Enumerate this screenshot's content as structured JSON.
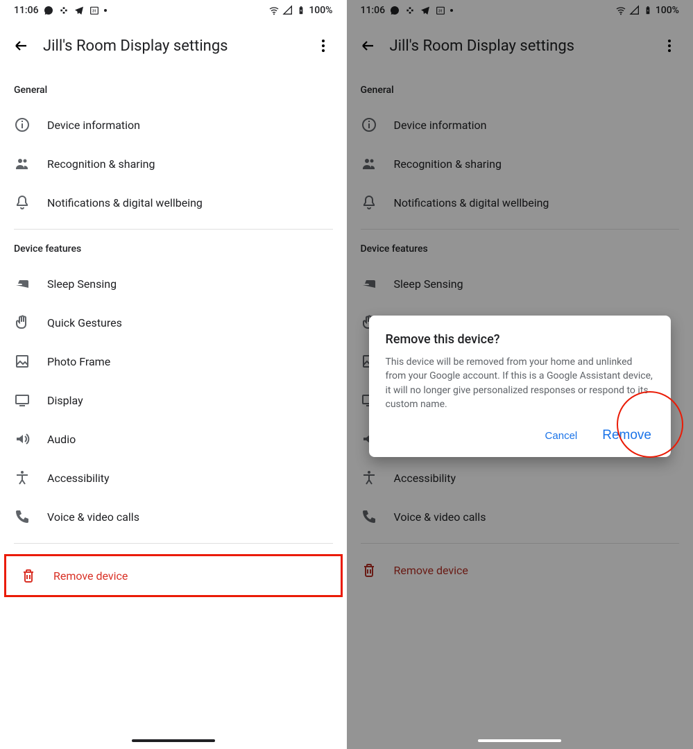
{
  "statusBar": {
    "time": "11:06",
    "battery": "100%"
  },
  "header": {
    "title": "Jill's Room Display settings"
  },
  "sections": {
    "general": {
      "header": "General",
      "items": [
        {
          "name": "device-information",
          "label": "Device information"
        },
        {
          "name": "recognition-sharing",
          "label": "Recognition & sharing"
        },
        {
          "name": "notifications-wellbeing",
          "label": "Notifications & digital wellbeing"
        }
      ]
    },
    "features": {
      "header": "Device features",
      "items": [
        {
          "name": "sleep-sensing",
          "label": "Sleep Sensing"
        },
        {
          "name": "quick-gestures",
          "label": "Quick Gestures"
        },
        {
          "name": "photo-frame",
          "label": "Photo Frame"
        },
        {
          "name": "display",
          "label": "Display"
        },
        {
          "name": "audio",
          "label": "Audio"
        },
        {
          "name": "accessibility",
          "label": "Accessibility"
        },
        {
          "name": "voice-video-calls",
          "label": "Voice & video calls"
        }
      ]
    },
    "remove": {
      "label": "Remove device"
    }
  },
  "dialog": {
    "title": "Remove this device?",
    "body": "This device will be removed from your home and unlinked from your Google account. If this is a Google Assistant device, it will no longer give personalized responses or respond to its custom name.",
    "cancel": "Cancel",
    "remove": "Remove"
  }
}
